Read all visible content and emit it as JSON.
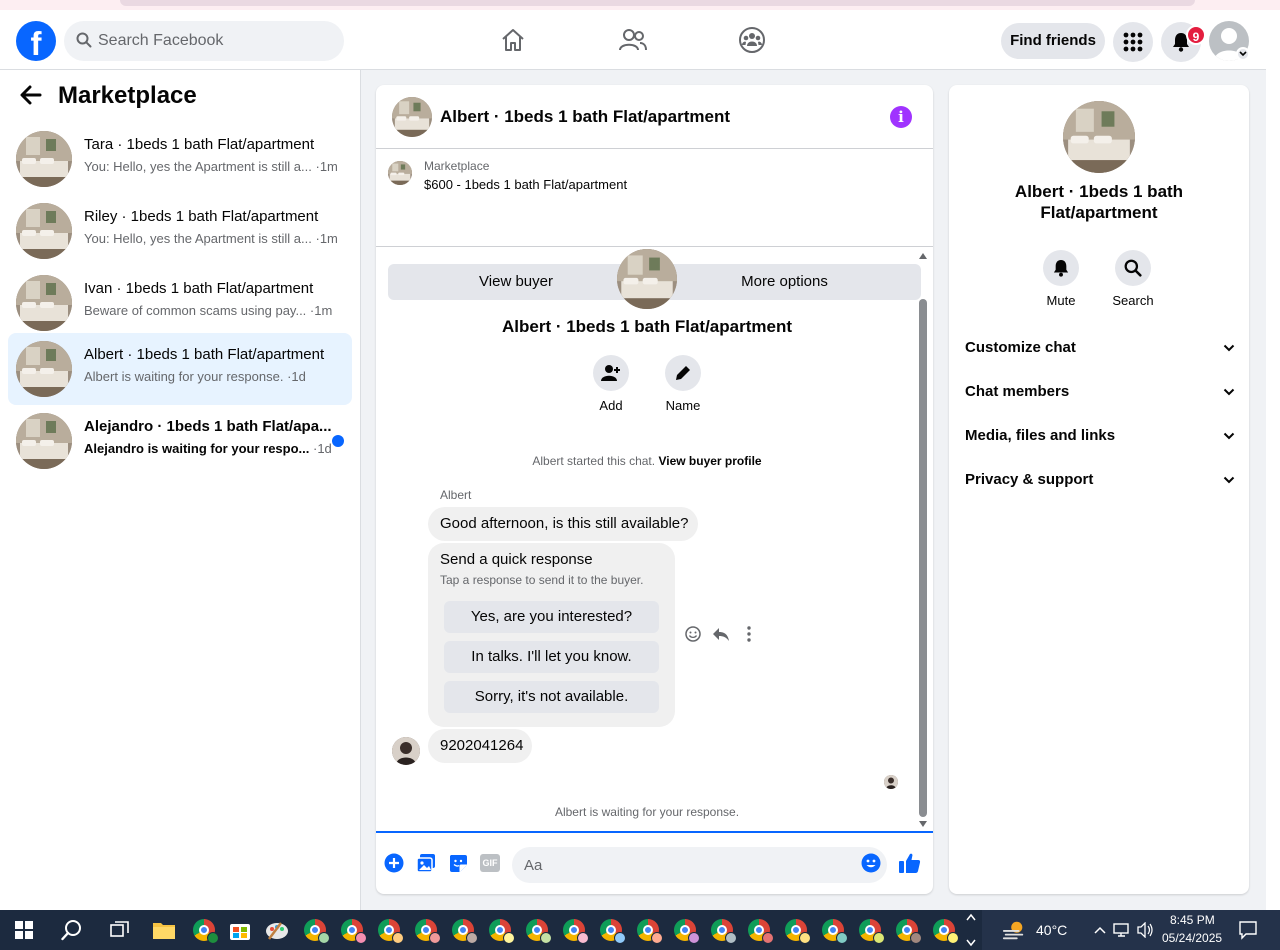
{
  "header": {
    "search_placeholder": "Search Facebook",
    "find_friends_label": "Find friends",
    "notification_count": "9",
    "logo_letter": "f"
  },
  "sidebar": {
    "title": "Marketplace",
    "conversations": [
      {
        "name": "Tara · 1beds 1 bath Flat/apartment",
        "preview": "You: Hello, yes the Apartment is still a...",
        "time": "·1m"
      },
      {
        "name": "Riley · 1beds 1 bath Flat/apartment",
        "preview": "You: Hello, yes the Apartment is still a...",
        "time": "·1m"
      },
      {
        "name": "Ivan · 1beds 1 bath Flat/apartment",
        "preview": "Beware of common scams using pay...",
        "time": "·1m"
      },
      {
        "name": "Albert · 1beds 1 bath Flat/apartment",
        "preview": "Albert is waiting for your response.",
        "time": "·1d"
      },
      {
        "name": "Alejandro · 1beds 1 bath Flat/apa...",
        "preview": "Alejandro is waiting for your respo...",
        "time": "·1d"
      }
    ]
  },
  "chat": {
    "title": "Albert · 1beds 1 bath Flat/apartment",
    "listing_label": "Marketplace",
    "listing_price": "$600 - 1beds 1 bath Flat/apartment",
    "view_buyer_label": "View buyer",
    "more_options_label": "More options",
    "body_title": "Albert · 1beds 1 bath Flat/apartment",
    "add_label": "Add",
    "name_label": "Name",
    "started_text": "Albert started this chat.",
    "view_profile_link": "View buyer profile",
    "sender_name": "Albert",
    "message_1": "Good afternoon, is this still available?",
    "quick_title": "Send a quick response",
    "quick_sub": "Tap a response to send it to the buyer.",
    "quick_responses": [
      "Yes, are you interested?",
      "In talks. I'll let you know.",
      "Sorry, it's not available."
    ],
    "message_2": "9202041264",
    "waiting_text": "Albert is waiting for your response.",
    "composer_placeholder": "Aa",
    "gif_label": "GIF"
  },
  "info_panel": {
    "title": "Albert · 1beds 1 bath Flat/apartment",
    "mute_label": "Mute",
    "search_label": "Search",
    "sections": [
      "Customize chat",
      "Chat members",
      "Media, files and links",
      "Privacy & support"
    ]
  },
  "taskbar": {
    "temperature": "40°C",
    "time": "8:45 PM",
    "date": "05/24/2025"
  },
  "colors": {
    "facebook_blue": "#0866ff",
    "messenger_purple": "#a033ff",
    "active_row": "#e7f3ff",
    "badge_red": "#e41e3f"
  }
}
